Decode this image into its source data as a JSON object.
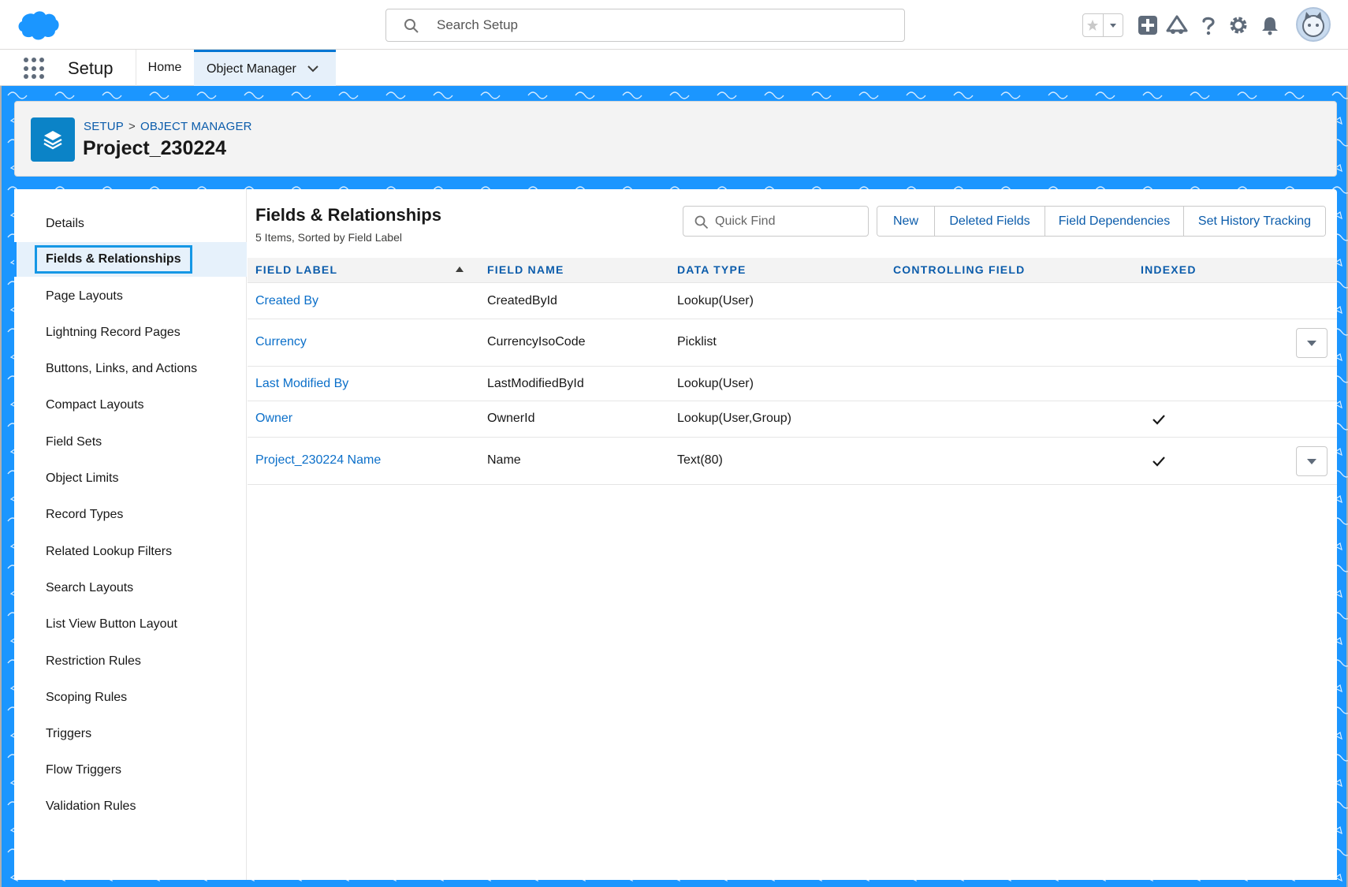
{
  "header": {
    "search_placeholder": "Search Setup",
    "icons": [
      "salesforce-cloud-logo",
      "star-icon",
      "chevron-down-icon",
      "add-icon",
      "trailhead-icon",
      "help-icon",
      "gear-icon",
      "bell-icon",
      "avatar"
    ]
  },
  "app_nav": {
    "app_name": "Setup",
    "tabs": [
      {
        "label": "Home"
      },
      {
        "label": "Object Manager"
      }
    ]
  },
  "object_header": {
    "breadcrumb": [
      "SETUP",
      "OBJECT MANAGER"
    ],
    "breadcrumb_sep": ">",
    "title": "Project_230224"
  },
  "sidebar": {
    "items": [
      {
        "label": "Details"
      },
      {
        "label": "Fields & Relationships"
      },
      {
        "label": "Page Layouts"
      },
      {
        "label": "Lightning Record Pages"
      },
      {
        "label": "Buttons, Links, and Actions"
      },
      {
        "label": "Compact Layouts"
      },
      {
        "label": "Field Sets"
      },
      {
        "label": "Object Limits"
      },
      {
        "label": "Record Types"
      },
      {
        "label": "Related Lookup Filters"
      },
      {
        "label": "Search Layouts"
      },
      {
        "label": "List View Button Layout"
      },
      {
        "label": "Restriction Rules"
      },
      {
        "label": "Scoping Rules"
      },
      {
        "label": "Triggers"
      },
      {
        "label": "Flow Triggers"
      },
      {
        "label": "Validation Rules"
      }
    ],
    "selected": "Fields & Relationships"
  },
  "main": {
    "title": "Fields & Relationships",
    "subtitle": "5 Items, Sorted by Field Label",
    "quick_find_placeholder": "Quick Find",
    "buttons": [
      {
        "label": "New"
      },
      {
        "label": "Deleted Fields"
      },
      {
        "label": "Field Dependencies"
      },
      {
        "label": "Set History Tracking"
      }
    ],
    "columns": [
      "FIELD LABEL",
      "FIELD NAME",
      "DATA TYPE",
      "CONTROLLING FIELD",
      "INDEXED"
    ],
    "rows": [
      {
        "label": "Created By",
        "name": "CreatedById",
        "type": "Lookup(User)",
        "controlling": "",
        "indexed": false,
        "has_menu": false
      },
      {
        "label": "Currency",
        "name": "CurrencyIsoCode",
        "type": "Picklist",
        "controlling": "",
        "indexed": false,
        "has_menu": true
      },
      {
        "label": "Last Modified By",
        "name": "LastModifiedById",
        "type": "Lookup(User)",
        "controlling": "",
        "indexed": false,
        "has_menu": false
      },
      {
        "label": "Owner",
        "name": "OwnerId",
        "type": "Lookup(User,Group)",
        "controlling": "",
        "indexed": true,
        "has_menu": false
      },
      {
        "label": "Project_230224 Name",
        "name": "Name",
        "type": "Text(80)",
        "controlling": "",
        "indexed": true,
        "has_menu": true
      }
    ]
  },
  "colors": {
    "brand_blue": "#1b96ff",
    "link_blue": "#0b6fc9",
    "object_icon": "#0b83c7",
    "selection_outline": "#1597e5"
  }
}
